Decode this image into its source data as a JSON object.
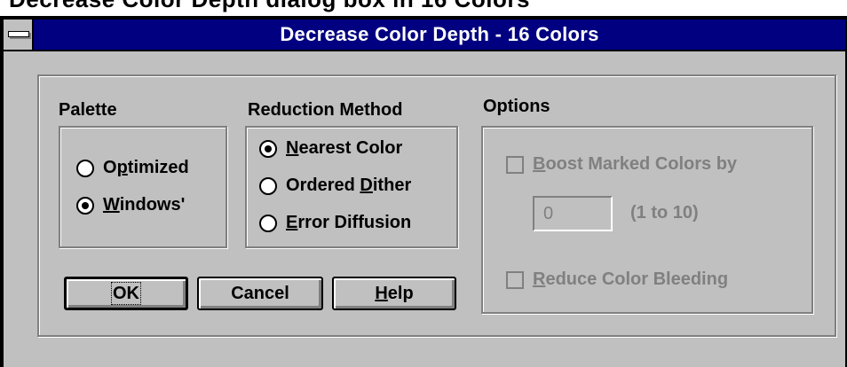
{
  "cropped_heading": "Decrease Color Depth dialog box in 16 Colors",
  "window": {
    "title": "Decrease Color Depth - 16 Colors"
  },
  "palette": {
    "label": "Palette",
    "options": [
      {
        "label": "Optimized",
        "mnemonic_index": 1,
        "selected": false
      },
      {
        "label": "Windows'",
        "mnemonic_index": 0,
        "selected": true
      }
    ]
  },
  "reduction": {
    "label": "Reduction Method",
    "options": [
      {
        "label": "Nearest Color",
        "mnemonic_index": 0,
        "selected": true
      },
      {
        "label": "Ordered Dither",
        "mnemonic_index": 8,
        "selected": false
      },
      {
        "label": "Error Diffusion",
        "mnemonic_index": 0,
        "selected": false
      }
    ]
  },
  "options": {
    "label": "Options",
    "boost_label": "Boost Marked Colors by",
    "boost_value": "0",
    "boost_range": "(1 to 10)",
    "bleed_label": "Reduce Color Bleeding"
  },
  "buttons": {
    "ok": "OK",
    "cancel": "Cancel",
    "help": "Help"
  },
  "colors": {
    "face": "#c0c0c0",
    "title_bar": "#000080",
    "disabled_text": "#808080"
  }
}
